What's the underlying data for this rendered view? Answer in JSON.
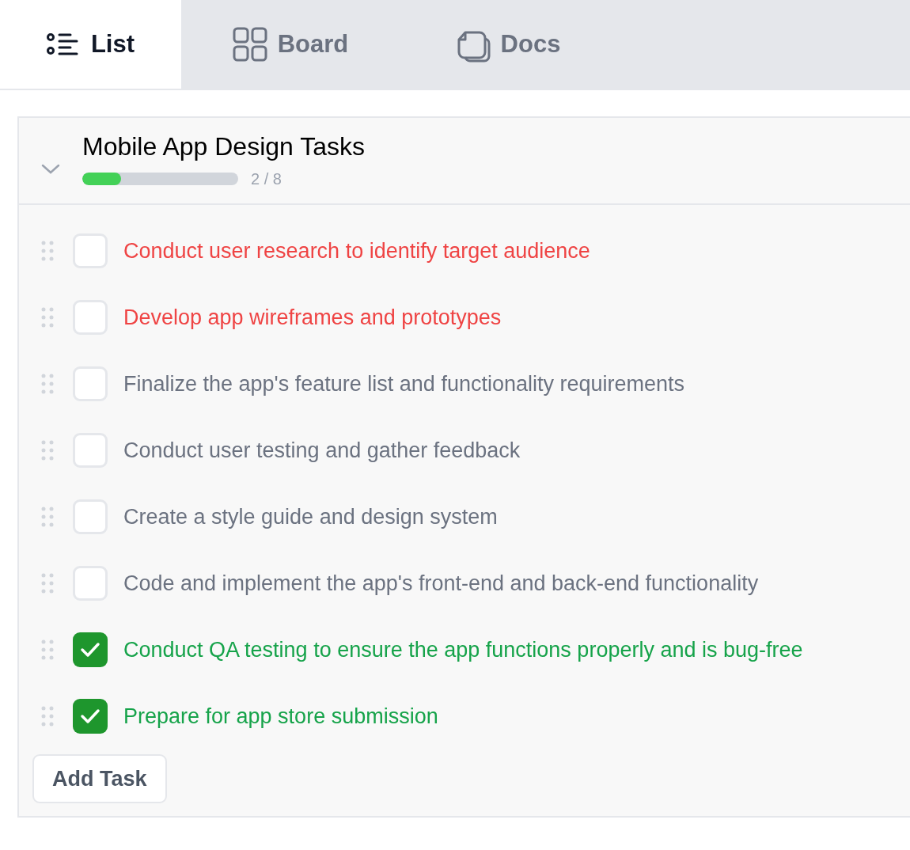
{
  "tabs": [
    {
      "label": "List",
      "kind": "list",
      "selected": true
    },
    {
      "label": "Board",
      "kind": "board",
      "selected": false
    },
    {
      "label": "Docs",
      "kind": "docs",
      "selected": false
    }
  ],
  "group": {
    "title": "Mobile App Design Tasks",
    "expanded": true,
    "level": 0.25,
    "count": "2 / 8"
  },
  "tasks": [
    {
      "label": "Conduct user research to identify target audience",
      "checked": false,
      "color": "#ef4444"
    },
    {
      "label": "Develop app wireframes and prototypes",
      "checked": false,
      "color": "#ef4444"
    },
    {
      "label": "Finalize the app's feature list and functionality requirements",
      "checked": false,
      "color": "#6b7280"
    },
    {
      "label": "Conduct user testing and gather feedback",
      "checked": false,
      "color": "#6b7280"
    },
    {
      "label": "Create a style guide and design system",
      "checked": false,
      "color": "#6b7280"
    },
    {
      "label": "Code and implement the app's front-end and back-end functionality",
      "checked": false,
      "color": "#6b7280"
    },
    {
      "label": "Conduct QA testing to ensure the app functions properly and is bug-free",
      "checked": true,
      "color": "#16a34a"
    },
    {
      "label": "Prepare for app store submission",
      "checked": true,
      "color": "#16a34a"
    }
  ],
  "add_button": "Add Task"
}
